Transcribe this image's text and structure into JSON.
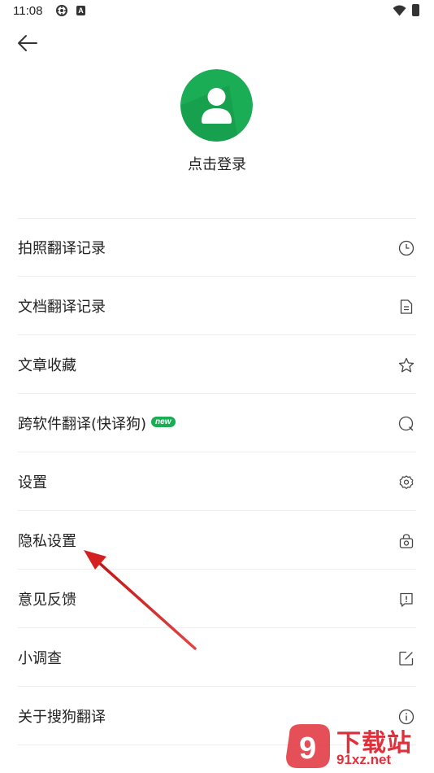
{
  "status_bar": {
    "time": "11:08",
    "icon_a": "settings-sync-icon",
    "icon_b_letter": "A"
  },
  "header": {
    "back_icon": "back-arrow-icon"
  },
  "profile": {
    "avatar_icon": "user-avatar-icon",
    "login_label": "点击登录",
    "avatar_color": "#1aad55"
  },
  "menu": {
    "items": [
      {
        "label": "拍照翻译记录",
        "icon": "history-clock-icon"
      },
      {
        "label": "文档翻译记录",
        "icon": "document-icon"
      },
      {
        "label": "文章收藏",
        "icon": "star-icon"
      },
      {
        "label": "跨软件翻译(快译狗)",
        "icon": "search-icon",
        "badge": "new"
      },
      {
        "label": "设置",
        "icon": "gear-icon"
      },
      {
        "label": "隐私设置",
        "icon": "privacy-lock-icon"
      },
      {
        "label": "意见反馈",
        "icon": "feedback-icon"
      },
      {
        "label": "小调查",
        "icon": "edit-icon"
      },
      {
        "label": "关于搜狗翻译",
        "icon": "info-icon"
      }
    ]
  },
  "watermark": {
    "title": "下载站",
    "url": "91xz.net",
    "logo_text": "9"
  },
  "colors": {
    "accent": "#1aad55",
    "annotation_arrow": "#d42020",
    "divider": "#eeeeee"
  }
}
